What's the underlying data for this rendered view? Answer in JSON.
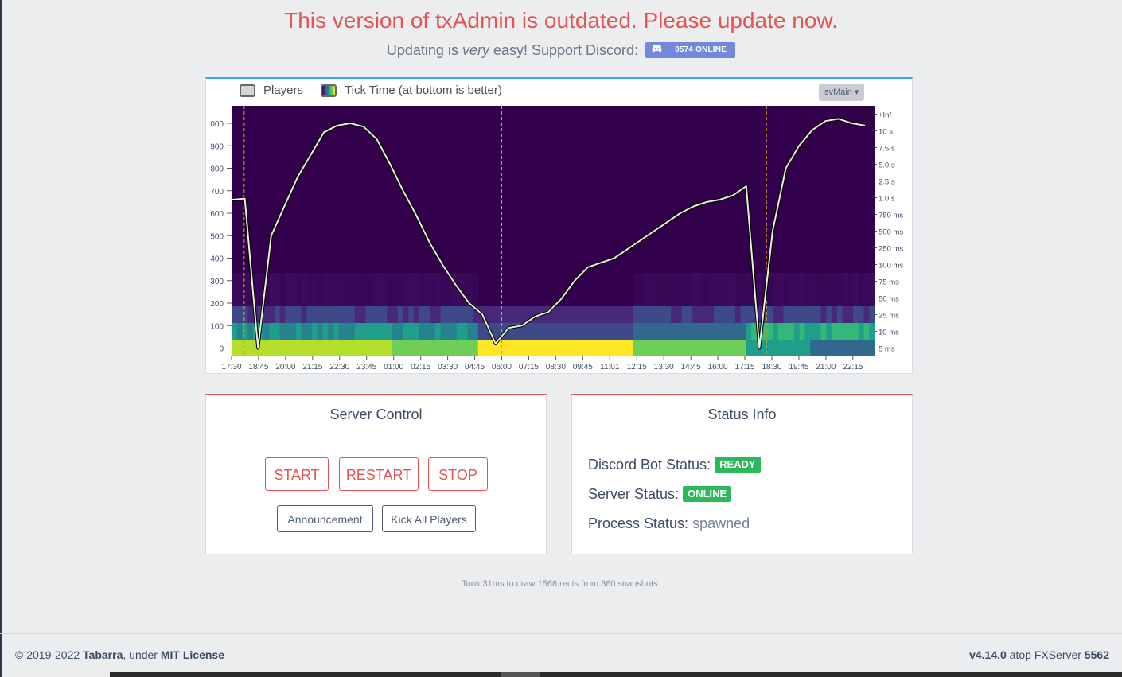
{
  "banner": {
    "outdated_text": "This version of txAdmin is outdated. Please update now.",
    "support_prefix": "Updating is ",
    "support_em": "very",
    "support_suffix": " easy! Support Discord:",
    "discord_online": "9574 ONLINE",
    "discord_color": "#7289da"
  },
  "chart_panel": {
    "legend_players": "Players",
    "legend_ticktime": "Tick Time (at bottom is better)",
    "thread_select": "svMain",
    "chart_data": {
      "type": "heatmap",
      "title": "",
      "series": [
        {
          "name": "Players",
          "x_hours": [
            0,
            0.25,
            0.5,
            0.75,
            1,
            1.5,
            2,
            2.5,
            3,
            3.5,
            4,
            4.5,
            5,
            5.5,
            6,
            6.5,
            7,
            7.5,
            8,
            8.5,
            9,
            9.5,
            10,
            10.5,
            11,
            11.5,
            12,
            12.5,
            12.75,
            12.85,
            13,
            13.5,
            14,
            14.5,
            15,
            15.5,
            16,
            16.5,
            17,
            17.5,
            18,
            18.5,
            19,
            19.5,
            20,
            20.5,
            21,
            21.5,
            22,
            22.5,
            23,
            23.5,
            24,
            24.25,
            24.5,
            24.75,
            25,
            25.5,
            26,
            26.5,
            27,
            27.5,
            28,
            28.5,
            29,
            29.5,
            30,
            30.5,
            30.75
          ],
          "values": [
            660,
            665,
            0,
            500,
            630,
            760,
            860,
            960,
            990,
            1000,
            985,
            930,
            820,
            700,
            590,
            470,
            370,
            280,
            200,
            150,
            20,
            90,
            100,
            140,
            160,
            220,
            300,
            360,
            380,
            400,
            440,
            480,
            520,
            560,
            600,
            630,
            650,
            660,
            680,
            720,
            0,
            520,
            800,
            900,
            970,
            1010,
            1020,
            1000,
            990
          ]
        },
        {
          "name": "Tick Time",
          "values": []
        }
      ],
      "x_ticks": [
        "17:30",
        "18:45",
        "20:00",
        "21:15",
        "22:30",
        "23:45",
        "01:00",
        "02:15",
        "03:30",
        "04:45",
        "06:00",
        "07:15",
        "08:30",
        "09:45",
        "11:01",
        "12:15",
        "13:30",
        "14:45",
        "16:00",
        "17:15",
        "18:30",
        "19:45",
        "21:00",
        "22:15"
      ],
      "y_left_ticks": [
        "000",
        "900",
        "800",
        "700",
        "600",
        "500",
        "400",
        "300",
        "200",
        "100",
        "0"
      ],
      "y_right_ticks": [
        "+Inf",
        "10 s",
        "7.5 s",
        "5.0 s",
        "2.5 s",
        "1.0 s",
        "750 ms",
        "500 ms",
        "250 ms",
        "100 ms",
        "75 ms",
        "50 ms",
        "25 ms",
        "10 ms",
        "5 ms"
      ],
      "restart_markers": [
        "18:05",
        "06:00",
        "18:15"
      ],
      "colors": {
        "bg": "#32004a",
        "line": "#e8f0d8",
        "marker": "#e0a030"
      }
    }
  },
  "server_control": {
    "title": "Server Control",
    "start": "START",
    "restart": "RESTART",
    "stop": "STOP",
    "announcement": "Announcement",
    "kick_all": "Kick All Players"
  },
  "status_info": {
    "title": "Status Info",
    "discord_label": "Discord Bot Status:",
    "discord_value": "READY",
    "server_label": "Server Status:",
    "server_value": "ONLINE",
    "process_label": "Process Status:",
    "process_value": "spawned"
  },
  "took_text": "Took 31ms to draw 1566 rects from 360 snapshots.",
  "footer": {
    "copyright": "© 2019-2022 ",
    "author": "Tabarra",
    "under": ", under ",
    "license": "MIT License",
    "version": "v4.14.0",
    "atop": " atop FXServer ",
    "build": "5562"
  }
}
